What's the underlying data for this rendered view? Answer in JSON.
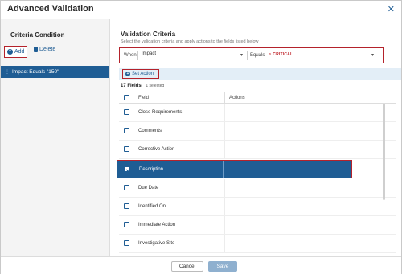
{
  "dialog": {
    "title": "Advanced Validation",
    "close_icon": "close-icon"
  },
  "left": {
    "title": "Criteria Condition",
    "add_label": "Add",
    "delete_label": "Delete",
    "criteria_items": [
      "Impact Equals \"150\""
    ]
  },
  "right": {
    "title": "Validation Criteria",
    "subtitle": "Select the validation criteria and apply actions to the fields listed below",
    "when_label": "When",
    "when_value": "Impact",
    "operator_label": "Equals",
    "operator_value": "CRITICAL",
    "set_action_label": "Set Action",
    "count": "17 Fields",
    "selected_count": "1 selected"
  },
  "grid": {
    "headers": {
      "field": "Field",
      "actions": "Actions"
    },
    "rows": [
      {
        "field": "Close Requirements",
        "checked": false
      },
      {
        "field": "Comments",
        "checked": false
      },
      {
        "field": "Corrective Action",
        "checked": false
      },
      {
        "field": "Description",
        "checked": true
      },
      {
        "field": "Due Date",
        "checked": false
      },
      {
        "field": "Identified On",
        "checked": false
      },
      {
        "field": "Immediate Action",
        "checked": false
      },
      {
        "field": "Investigative Site",
        "checked": false
      }
    ]
  },
  "footer": {
    "cancel_label": "Cancel",
    "save_label": "Save"
  },
  "colors": {
    "primary": "#1f5d94",
    "highlight": "#b4222b",
    "critical": "#c0272d"
  }
}
